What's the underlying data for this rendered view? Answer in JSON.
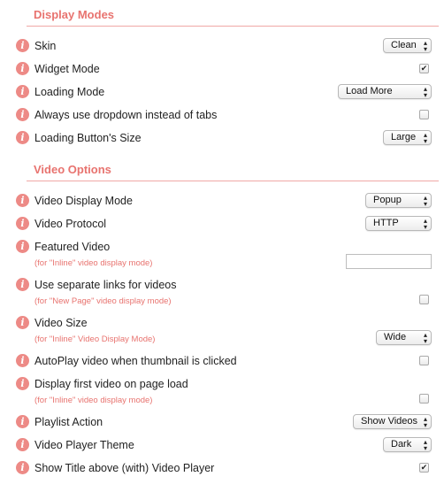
{
  "sections": {
    "display_modes": {
      "title": "Display Modes",
      "skin": {
        "label": "Skin",
        "value": "Clean"
      },
      "widget_mode": {
        "label": "Widget Mode",
        "checked": true
      },
      "loading_mode": {
        "label": "Loading Mode",
        "value": "Load More"
      },
      "always_dropdown": {
        "label": "Always use dropdown instead of tabs",
        "checked": false
      },
      "loading_button_size": {
        "label": "Loading Button's Size",
        "value": "Large"
      }
    },
    "video_options": {
      "title": "Video Options",
      "video_display_mode": {
        "label": "Video Display Mode",
        "value": "Popup"
      },
      "video_protocol": {
        "label": "Video Protocol",
        "value": "HTTP"
      },
      "featured_video": {
        "label": "Featured Video",
        "sublabel": "(for \"Inline\" video display mode)",
        "value": ""
      },
      "separate_links": {
        "label": "Use separate links for videos",
        "sublabel": "(for \"New Page\" video display mode)",
        "checked": false
      },
      "video_size": {
        "label": "Video Size",
        "sublabel": "(for \"Inline\" Video Display Mode)",
        "value": "Wide"
      },
      "autoplay": {
        "label": "AutoPlay video when thumbnail is clicked",
        "checked": false
      },
      "display_first": {
        "label": "Display first video on page load",
        "sublabel": "(for \"Inline\" video display mode)",
        "checked": false
      },
      "playlist_action": {
        "label": "Playlist Action",
        "value": "Show Videos"
      },
      "player_theme": {
        "label": "Video Player Theme",
        "value": "Dark"
      },
      "show_title": {
        "label": "Show Title above (with) Video Player",
        "checked": true
      }
    }
  },
  "icons": {
    "info": "i",
    "check": "✔",
    "chevron": "▴▾"
  },
  "colors": {
    "accent": "#e8736f",
    "info_icon": "#ed8a86",
    "rule": "#f0a8a6"
  }
}
